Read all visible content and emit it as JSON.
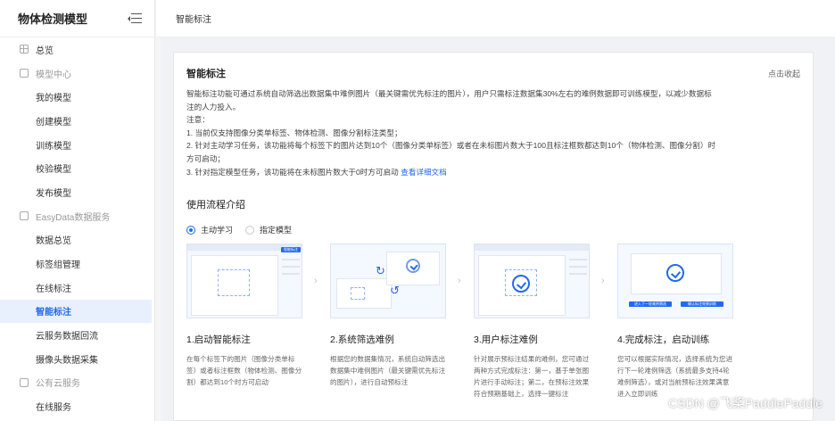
{
  "sidebar": {
    "title": "物体检测模型",
    "items": [
      {
        "label": "总览",
        "kind": "top",
        "icon": "grid-icon"
      },
      {
        "label": "模型中心",
        "kind": "group",
        "icon": "model-icon"
      },
      {
        "label": "我的模型",
        "kind": "sub"
      },
      {
        "label": "创建模型",
        "kind": "sub"
      },
      {
        "label": "训练模型",
        "kind": "sub"
      },
      {
        "label": "校验模型",
        "kind": "sub"
      },
      {
        "label": "发布模型",
        "kind": "sub"
      },
      {
        "label": "EasyData数据服务",
        "kind": "group",
        "icon": "data-icon"
      },
      {
        "label": "数据总览",
        "kind": "sub"
      },
      {
        "label": "标签组管理",
        "kind": "sub"
      },
      {
        "label": "在线标注",
        "kind": "sub"
      },
      {
        "label": "智能标注",
        "kind": "sub",
        "active": true
      },
      {
        "label": "云服务数据回流",
        "kind": "sub"
      },
      {
        "label": "摄像头数据采集",
        "kind": "sub"
      },
      {
        "label": "公有云服务",
        "kind": "group",
        "icon": "cloud-icon"
      },
      {
        "label": "在线服务",
        "kind": "sub"
      }
    ]
  },
  "topbar": {
    "breadcrumb": "智能标注"
  },
  "card": {
    "title": "智能标注",
    "collapse_label": "点击收起",
    "intro": "智能标注功能可通过系统自动筛选出数据集中难例图片（最关键需优先标注的图片），用户只需标注数据集30%左右的难例数据即可训练模型，以减少数据标注的人力投入。",
    "note_title": "注意：",
    "note_1": "1. 当前仅支持图像分类单标签、物体检测、图像分割标注类型；",
    "note_2": "2. 针对主动学习任务，该功能将每个标签下的图片达到10个（图像分类单标签）或者在未标图片数大于100且标注框数都达到10个（物体检测、图像分割）时方可启动；",
    "note_3": "3. 针对指定模型任务，该功能将在未标图片数大于0时方可启动",
    "doc_link": "查看详细文档",
    "flow_title": "使用流程介绍",
    "radio_active": "主动学习",
    "radio_specified": "指定模型",
    "steps": [
      {
        "title": "1.启动智能标注",
        "desc": "在每个标签下的图片（图像分类单标签）或者标注框数（物体检测、图像分割）都达到10个时方可启动",
        "thumb_button": "智能标注"
      },
      {
        "title": "2.系统筛选难例",
        "desc": "根据您的数据集情况，系统自动筛选出数据集中难例图片（最关键需优先标注的图片），进行自动预标注"
      },
      {
        "title": "3.用户标注难例",
        "desc": "针对展示预标注结果的难例，您可通过两种方式完成标注：第一，基于单张图片进行手动标注；第二，在预标注效果符合预期基础上，选择一键标注"
      },
      {
        "title": "4.完成标注，启动训练",
        "desc": "您可以根据实际情况，选择系统为您进行下一轮难例筛选（系统最多支持4轮难例筛选），或对当前预标注效果满意进入立即训练",
        "thumb_btn_1": "进入下一轮难例筛选",
        "thumb_btn_2": "确认标注效果训练"
      }
    ]
  },
  "watermark": "CSDN @飞桨PaddlePaddle",
  "colors": {
    "accent": "#2468f2",
    "active_bg": "#e8f0fd",
    "page_bg": "#f0f2f5"
  }
}
